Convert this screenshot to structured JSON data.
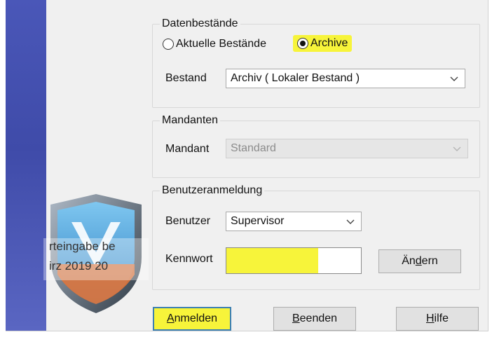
{
  "data_group": {
    "title": "Datenbestände",
    "radio_current": "Aktuelle Bestände",
    "radio_archive": "Archive",
    "stock_label": "Bestand",
    "stock_value": "Archiv ( Lokaler Bestand )"
  },
  "client_group": {
    "title": "Mandanten",
    "client_label": "Mandant",
    "client_value": "Standard"
  },
  "login_group": {
    "title": "Benutzeranmeldung",
    "user_label": "Benutzer",
    "user_value": "Supervisor",
    "password_label": "Kennwort",
    "change_prefix": "Än",
    "change_ul": "d",
    "change_suffix": "ern"
  },
  "buttons": {
    "login_ul": "A",
    "login_rest": "nmelden",
    "exit_ul": "B",
    "exit_rest": "eenden",
    "help_ul": "H",
    "help_rest": "ilfe"
  },
  "logo": {
    "line1": "rteingabe be",
    "line2": "irz 2019  20"
  },
  "colors": {
    "highlight": "#f7f43a",
    "sidebar": "#4a57b8",
    "default_button_border": "#3c7fb1"
  },
  "icons": {
    "dropdown": "chevron-down-icon",
    "logo": "shield-logo-icon"
  }
}
